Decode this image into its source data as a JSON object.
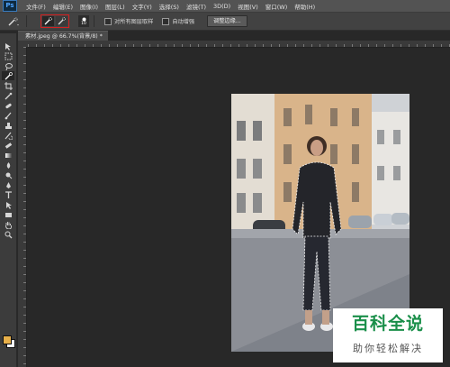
{
  "app": {
    "logo": "Ps"
  },
  "menu": {
    "items": [
      "文件(F)",
      "编辑(E)",
      "图像(I)",
      "图层(L)",
      "文字(Y)",
      "选择(S)",
      "滤镜(T)",
      "3D(D)",
      "视图(V)",
      "窗口(W)",
      "帮助(H)"
    ]
  },
  "options_bar": {
    "brush_size": "10",
    "sample_all_layers": "对所有图层取样",
    "auto_enhance": "自动增强",
    "refine_edge": "调整边缘..."
  },
  "document": {
    "tab_title": "素材.jpeg @ 66.7%(背景/8) *"
  },
  "colors": {
    "foreground": "#e8b04a",
    "background": "#ffffff",
    "highlight_border": "#d42020"
  },
  "watermark": {
    "title": "百科全说",
    "subtitle": "助你轻松解决"
  },
  "icons": {
    "tools": [
      "move-icon",
      "marquee-icon",
      "lasso-icon",
      "quick-selection-icon",
      "crop-icon",
      "eyedropper-icon",
      "spot-healing-icon",
      "brush-icon",
      "clone-stamp-icon",
      "history-brush-icon",
      "eraser-icon",
      "gradient-icon",
      "blur-icon",
      "dodge-icon",
      "pen-icon",
      "type-icon",
      "path-selection-icon",
      "rectangle-icon",
      "hand-icon",
      "zoom-icon"
    ]
  }
}
